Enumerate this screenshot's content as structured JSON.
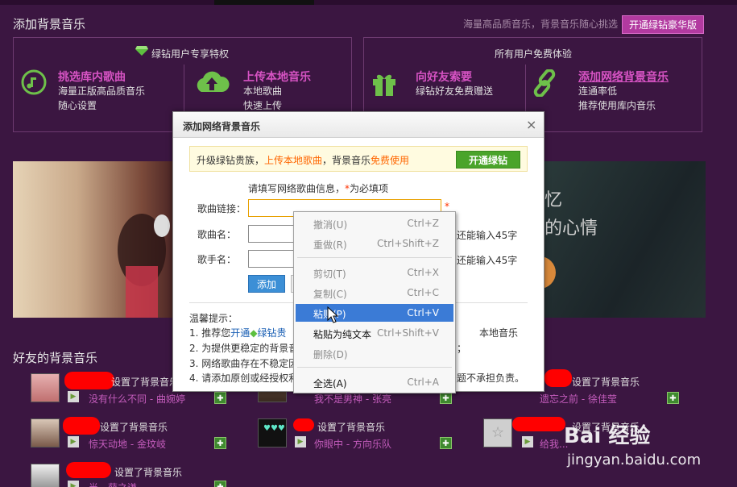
{
  "header": {
    "title": "添加背景音乐",
    "hint": "海量高品质音乐，背景音乐随心挑选",
    "vip_button": "开通绿钻豪华版"
  },
  "panel_vip": {
    "heading": "绿钻用户专享特权",
    "features": [
      {
        "title": "挑选库内歌曲",
        "desc1": "海量正版高品质音乐",
        "desc2": "随心设置"
      },
      {
        "title": "上传本地音乐",
        "desc1": "本地歌曲",
        "desc2": "快速上传"
      }
    ]
  },
  "panel_free": {
    "heading": "所有用户免费体验",
    "features": [
      {
        "title": "向好友索要",
        "desc1": "绿钻好友免费赠送",
        "desc2": ""
      },
      {
        "title": "添加网络背景音乐",
        "desc1": "连通率低",
        "desc2": "推荐使用库内音乐"
      }
    ]
  },
  "banner": {
    "right_text_1": "忆",
    "right_text_2": "的心情"
  },
  "friends": {
    "title": "好友的背景音乐",
    "set_text": "设置了背景音乐",
    "items": [
      {
        "song": "没有什么不同 - 曲婉婷"
      },
      {
        "song": "我不是男神 - 张亮"
      },
      {
        "song": "遗忘之前 - 徐佳莹"
      },
      {
        "song": "惊天动地 - 金玟岐"
      },
      {
        "song": "你眼中 - 方向乐队"
      },
      {
        "song": "给我..."
      },
      {
        "song": "半 - 薛之谦"
      }
    ]
  },
  "dialog": {
    "title": "添加网络背景音乐",
    "close": "×",
    "upgrade_prefix": "升级绿钻贵族，",
    "upgrade_orange": "上传本地歌曲",
    "upgrade_mid": "，背景音乐",
    "upgrade_orange2": "免费使用",
    "upgrade_button": "开通绿钻",
    "instruction": "请填写网络歌曲信息，",
    "instruction_req": "*",
    "instruction_suffix": "为必填项",
    "fields": {
      "link_label": "歌曲链接：",
      "name_label": "歌曲名：",
      "singer_label": "歌手名：",
      "required_mark": "*",
      "name_remain": "还能输入45字",
      "singer_remain": "还能输入45字"
    },
    "add_button": "添加",
    "tips_title": "温馨提示：",
    "tips": [
      {
        "a": "1. 推荐您",
        "link": "开通",
        "b": "绿钻贵",
        "c": "本地音乐"
      },
      {
        "a": "2. 为提供更稳定的背景音",
        "c": "；"
      },
      {
        "a": "3. 网络歌曲存在不稳定因",
        "c": ""
      },
      {
        "a": "4. 请添加原创或经授权利人",
        "c": "题不承担负责。"
      }
    ]
  },
  "context_menu": {
    "items": [
      {
        "label": "撤消(U)",
        "shortcut": "Ctrl+Z"
      },
      {
        "label": "重做(R)",
        "shortcut": "Ctrl+Shift+Z"
      },
      {
        "label": "剪切(T)",
        "shortcut": "Ctrl+X"
      },
      {
        "label": "复制(C)",
        "shortcut": "Ctrl+C"
      },
      {
        "label": "粘贴(P)",
        "shortcut": "Ctrl+V"
      },
      {
        "label": "粘贴为纯文本",
        "shortcut": "Ctrl+Shift+V"
      },
      {
        "label": "删除(D)",
        "shortcut": ""
      },
      {
        "label": "全选(A)",
        "shortcut": "Ctrl+A"
      }
    ]
  },
  "watermark": {
    "main": "Bai 经验",
    "sub": "jingyan.baidu.com"
  },
  "colors": {
    "page_bg": "#3b1641",
    "accent_pink": "#d653c3",
    "green": "#4aa42a",
    "menu_highlight": "#3b7bd6"
  }
}
